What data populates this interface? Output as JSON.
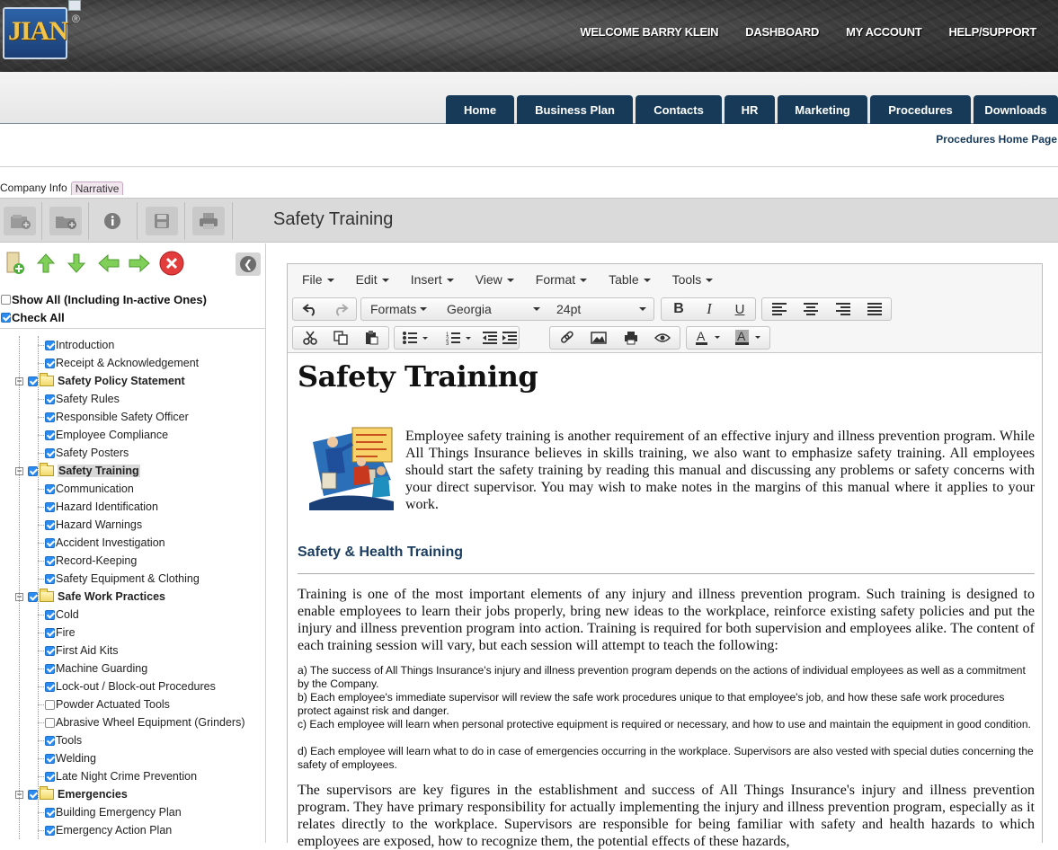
{
  "header": {
    "logo_text": "JIAN",
    "logo_mark": "®",
    "nav": [
      "WELCOME BARRY KLEIN",
      "DASHBOARD",
      "MY ACCOUNT",
      "HELP/SUPPORT"
    ]
  },
  "tabs": [
    "Home",
    "Business Plan",
    "Contacts",
    "HR",
    "Marketing",
    "Procedures",
    "Downloads"
  ],
  "breadcrumb_link": "Procedures Home Page",
  "subtabs": [
    "Company Info",
    "Narrative"
  ],
  "page_title": "Safety Training",
  "left_panel": {
    "show_all_label": "Show All (Including In-active Ones)",
    "check_all_label": "Check All",
    "tree": [
      {
        "label": "Introduction",
        "level": 2,
        "checked": true
      },
      {
        "label": "Receipt & Acknowledgement",
        "level": 2,
        "checked": true
      },
      {
        "label": "Safety Policy Statement",
        "level": 1,
        "checked": true,
        "folder": true
      },
      {
        "label": "Safety Rules",
        "level": 2,
        "checked": true
      },
      {
        "label": "Responsible Safety Officer",
        "level": 2,
        "checked": true
      },
      {
        "label": "Employee Compliance",
        "level": 2,
        "checked": true
      },
      {
        "label": "Safety Posters",
        "level": 2,
        "checked": true
      },
      {
        "label": "Safety Training",
        "level": 1,
        "checked": true,
        "folder": true,
        "selected": true
      },
      {
        "label": "Communication",
        "level": 2,
        "checked": true
      },
      {
        "label": "Hazard Identification",
        "level": 2,
        "checked": true
      },
      {
        "label": "Hazard Warnings",
        "level": 2,
        "checked": true
      },
      {
        "label": "Accident Investigation",
        "level": 2,
        "checked": true
      },
      {
        "label": "Record-Keeping",
        "level": 2,
        "checked": true
      },
      {
        "label": "Safety Equipment & Clothing",
        "level": 2,
        "checked": true
      },
      {
        "label": "Safe Work Practices",
        "level": 1,
        "checked": true,
        "folder": true
      },
      {
        "label": "Cold",
        "level": 2,
        "checked": true
      },
      {
        "label": "Fire",
        "level": 2,
        "checked": true
      },
      {
        "label": "First Aid Kits",
        "level": 2,
        "checked": true
      },
      {
        "label": "Machine Guarding",
        "level": 2,
        "checked": true
      },
      {
        "label": "Lock-out / Block-out Procedures",
        "level": 2,
        "checked": true
      },
      {
        "label": "Powder Actuated Tools",
        "level": 2,
        "checked": false
      },
      {
        "label": "Abrasive Wheel Equipment (Grinders)",
        "level": 2,
        "checked": false
      },
      {
        "label": "Tools",
        "level": 2,
        "checked": true
      },
      {
        "label": "Welding",
        "level": 2,
        "checked": true
      },
      {
        "label": "Late Night Crime Prevention",
        "level": 2,
        "checked": true
      },
      {
        "label": "Emergencies",
        "level": 1,
        "checked": true,
        "folder": true
      },
      {
        "label": "Building Emergency Plan",
        "level": 2,
        "checked": true
      },
      {
        "label": "Emergency Action Plan",
        "level": 2,
        "checked": true
      }
    ]
  },
  "editor": {
    "menus": [
      "File",
      "Edit",
      "Insert",
      "View",
      "Format",
      "Table",
      "Tools"
    ],
    "formats_label": "Formats",
    "font_family": "Georgia",
    "font_size": "24pt",
    "bold": "B",
    "italic": "I",
    "underline": "U",
    "heading": "Safety Training",
    "intro": "Employee safety training is another requirement of an effective injury and illness prevention program. While All Things Insurance believes in skills training, we also want to emphasize safety training. All employees should start the safety training by reading this manual and discussing any problems or safety concerns with your direct supervisor. You may wish to make notes in the margins of this manual where it applies to your work.",
    "subheading": "Safety & Health Training",
    "para1": "Training is one of the most important elements of any injury and illness prevention program. Such training is designed to enable employees to learn their jobs properly, bring new ideas to the workplace, reinforce existing safety policies and put the injury and illness prevention program into action. Training is required for both supervision and employees alike. The content of each training session will vary, but each session will attempt to teach the following:",
    "list_a": "a) The success of All Things Insurance's injury and illness prevention program depends on the actions of individual employees as well as a commitment by the Company.",
    "list_b": "b) Each employee's immediate supervisor will review the safe work procedures unique to that employee's job, and how these safe work procedures protect against risk and danger.",
    "list_c": "c) Each employee will learn when personal protective equipment is required or necessary, and how to use and maintain the equipment in good condition.",
    "list_d": "d) Each employee will learn what to do in case of emergencies occurring in the workplace. Supervisors are also vested with special duties concerning the safety of employees.",
    "para2": "The supervisors are key figures in the establishment and success of All Things Insurance's injury and illness prevention program. They have primary responsibility for actually implementing the injury and illness prevention program, especially as it relates directly to the workplace. Supervisors are responsible for being familiar with safety and health hazards to which employees are exposed, how to recognize them, the potential effects of these hazards,"
  }
}
